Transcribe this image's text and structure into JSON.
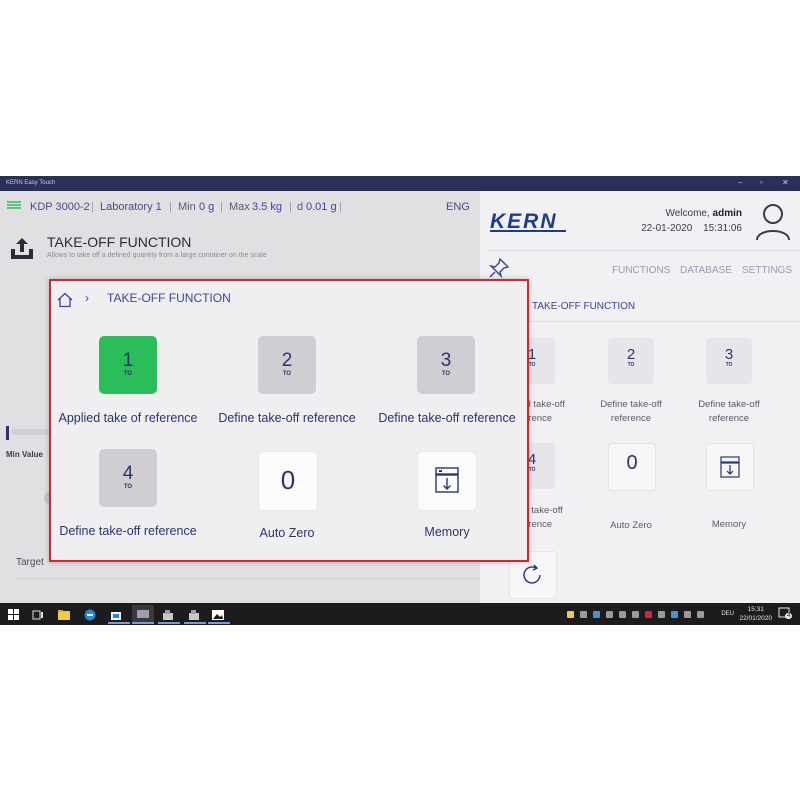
{
  "window": {
    "title": "KERN Easy Touch"
  },
  "infobar": {
    "device": "KDP 3000-2",
    "lab": "Laboratory 1",
    "min_label": "Min",
    "min_value": "0 g",
    "max_label": "Max",
    "max_value": "3.5 kg",
    "d_label": "d",
    "d_value": "0.01 g",
    "lang": "ENG"
  },
  "header": {
    "title": "TAKE-OFF FUNCTION",
    "subtitle": "Allows to take off a defined quantity from a large container on the scale"
  },
  "left": {
    "min_value_label": "Min Value",
    "target_label": "Target"
  },
  "right": {
    "welcome_prefix": "Welcome,",
    "user": "admin",
    "date": "22-01-2020",
    "time": "15:31:06",
    "nav": [
      "FUNCTIONS",
      "DATABASE",
      "SETTINGS"
    ],
    "breadcrumb": "TAKE-OFF FUNCTION",
    "tiles": [
      {
        "num": "1",
        "sub": "TO",
        "label": "Applied take-off reference"
      },
      {
        "num": "2",
        "sub": "TO",
        "label": "Define take-off reference"
      },
      {
        "num": "3",
        "sub": "TO",
        "label": "Define take-off reference"
      },
      {
        "num": "4",
        "sub": "TO",
        "label": "Define take-off reference"
      },
      {
        "num": "0",
        "sub": "",
        "label": "Auto Zero"
      },
      {
        "num": "",
        "sub": "",
        "label": "Memory"
      }
    ]
  },
  "popup": {
    "breadcrumb": "TAKE-OFF FUNCTION",
    "tiles": [
      {
        "num": "1",
        "sub": "TO",
        "label": "Applied take of reference",
        "active": true
      },
      {
        "num": "2",
        "sub": "TO",
        "label": "Define take-off reference"
      },
      {
        "num": "3",
        "sub": "TO",
        "label": "Define take-off reference"
      },
      {
        "num": "4",
        "sub": "TO",
        "label": "Define take-off reference"
      },
      {
        "num": "0",
        "sub": "",
        "label": "Auto Zero"
      },
      {
        "num": "",
        "sub": "",
        "label": "Memory"
      }
    ]
  },
  "taskbar": {
    "lang": "DEU",
    "time": "15:31",
    "date": "22/01/2020",
    "notif_count": "4"
  },
  "colors": {
    "accent": "#3a43a0",
    "active_tile": "#2bbd5a",
    "highlight_border": "#d9232e",
    "titlebar": "#2c2f57"
  }
}
